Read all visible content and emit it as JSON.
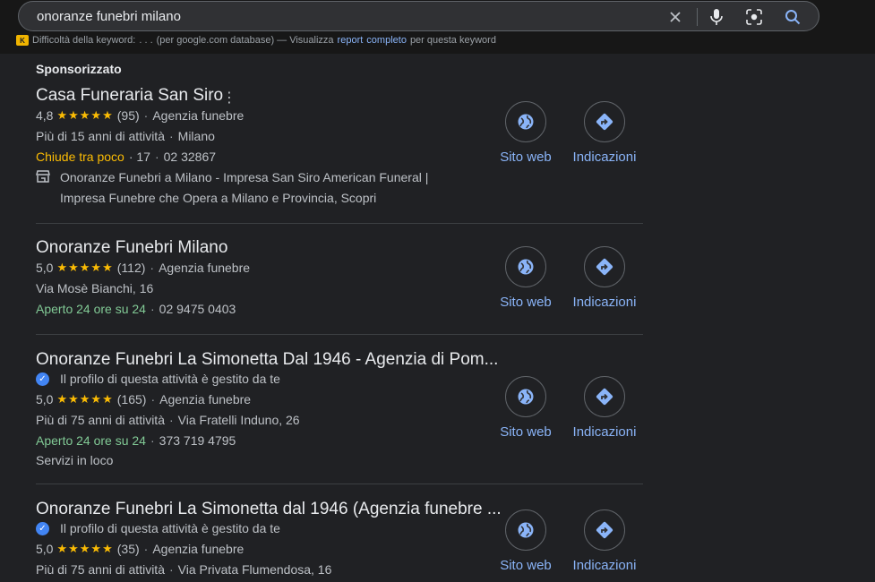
{
  "search": {
    "query": "onoranze funebri milano"
  },
  "keyword_bar": {
    "label": "Difficoltà della keyword:",
    "dots": ". . .",
    "db_text": "(per google.com database) — Visualizza",
    "link1": "report",
    "link2": "completo",
    "suffix": "per questa keyword"
  },
  "sponsored_label": "Sponsorizzato",
  "listings": [
    {
      "title": "Casa Funeraria San Siro",
      "rating": "4,8",
      "stars": "★★★★★",
      "reviews": "(95)",
      "category": "Agenzia funebre",
      "info": "Più di 15 anni di attività",
      "city": "Milano",
      "status": "Chiude tra poco",
      "status_extra": "· 17",
      "phone": "02 32867",
      "ad_line1": "Onoranze Funebri a Milano - Impresa San Siro American Funeral |",
      "ad_line2": "Impresa Funebre che Opera a Milano e Provincia, Scopri",
      "website_label": "Sito web",
      "directions_label": "Indicazioni"
    },
    {
      "title": "Onoranze Funebri Milano",
      "rating": "5,0",
      "stars": "★★★★★",
      "reviews": "(112)",
      "category": "Agenzia funebre",
      "address": "Via Mosè Bianchi, 16",
      "status": "Aperto 24 ore su 24",
      "phone": "02 9475 0403",
      "website_label": "Sito web",
      "directions_label": "Indicazioni"
    },
    {
      "title": "Onoranze Funebri La Simonetta Dal 1946 - Agenzia di Pom...",
      "managed": "Il profilo di questa attività è gestito da te",
      "rating": "5,0",
      "stars": "★★★★★",
      "reviews": "(165)",
      "category": "Agenzia funebre",
      "info": "Più di 75 anni di attività",
      "address": "Via Fratelli Induno, 26",
      "status": "Aperto 24 ore su 24",
      "phone": "373 719 4795",
      "services": "Servizi in loco",
      "website_label": "Sito web",
      "directions_label": "Indicazioni"
    },
    {
      "title": "Onoranze Funebri La Simonetta dal 1946 (Agenzia funebre ...",
      "managed": "Il profilo di questa attività è gestito da te",
      "rating": "5,0",
      "stars": "★★★★★",
      "reviews": "(35)",
      "category": "Agenzia funebre",
      "info": "Più di 75 anni di attività",
      "address": "Via Privata Flumendosa, 16",
      "website_label": "Sito web",
      "directions_label": "Indicazioni"
    }
  ],
  "icons": {
    "clear": "close-icon",
    "voice": "microphone-icon",
    "lens": "camera-lens-icon",
    "search": "search-icon",
    "website": "globe-icon",
    "directions": "directions-icon",
    "store": "store-icon",
    "verified": "verified-check-icon"
  },
  "colors": {
    "background": "#202124",
    "link": "#8ab4f8",
    "stars": "#fbbc04",
    "open": "#81c995",
    "closing": "#fbbc04"
  }
}
